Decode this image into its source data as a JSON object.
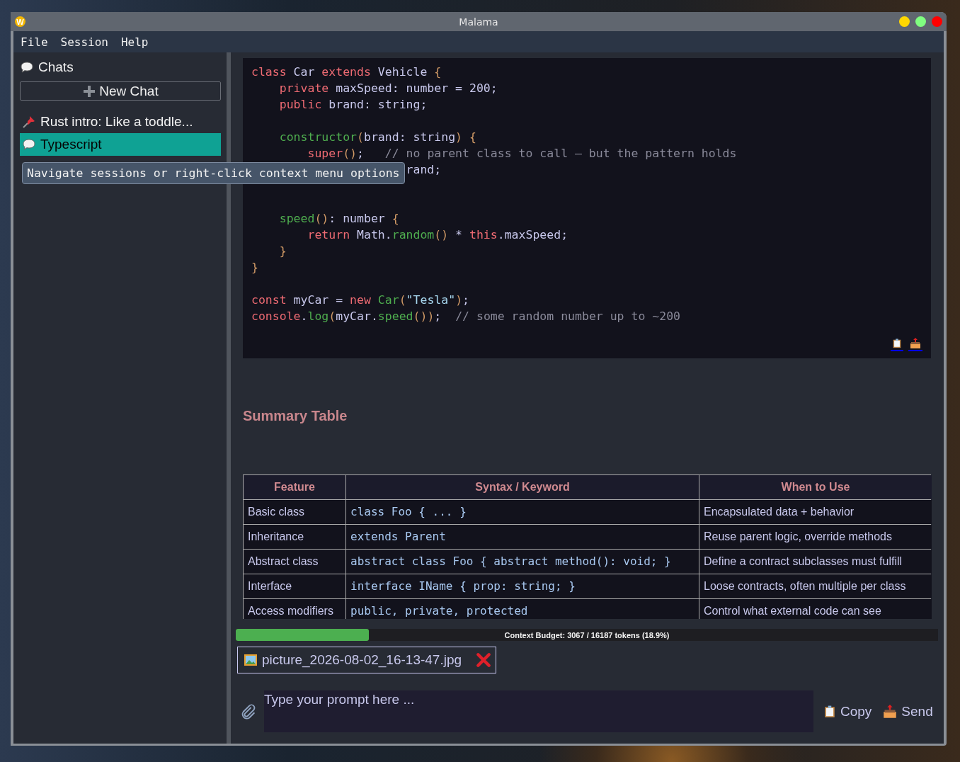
{
  "window": {
    "logo_letter": "W",
    "title": "Malama"
  },
  "menu": [
    "File",
    "Session",
    "Help"
  ],
  "sidebar": {
    "heading": "Chats",
    "new_chat_button": "New Chat",
    "sessions": [
      {
        "kind": "pinned",
        "title": "Rust intro: Like a toddle...",
        "selected": false
      },
      {
        "kind": "chat",
        "title": "Typescript",
        "selected": true
      }
    ]
  },
  "tooltip": "Navigate sessions or right-click context menu options",
  "code_block": {
    "lines": [
      {
        "kind": "code",
        "tokens": [
          {
            "kind": "kw",
            "text": "class"
          },
          {
            "kind": "id",
            "text": " Car "
          },
          {
            "kind": "kw",
            "text": "extends"
          },
          {
            "kind": "id",
            "text": " Vehicle "
          },
          {
            "kind": "p",
            "text": "{"
          }
        ]
      },
      {
        "kind": "code",
        "tokens": [
          {
            "kind": "kw",
            "text": "    private"
          },
          {
            "kind": "id",
            "text": " maxSpeed: number = 200;"
          }
        ]
      },
      {
        "kind": "code",
        "tokens": [
          {
            "kind": "kw",
            "text": "    public"
          },
          {
            "kind": "id",
            "text": " brand: string;"
          }
        ]
      },
      {
        "kind": "blank"
      },
      {
        "kind": "code",
        "tokens": [
          {
            "kind": "fn",
            "text": "    constructor"
          },
          {
            "kind": "p",
            "text": "("
          },
          {
            "kind": "id",
            "text": "brand: string"
          },
          {
            "kind": "p",
            "text": ")"
          },
          {
            "kind": "p",
            "text": " {"
          }
        ]
      },
      {
        "kind": "code",
        "tokens": [
          {
            "kind": "kw",
            "text": "        super"
          },
          {
            "kind": "p",
            "text": "()"
          },
          {
            "kind": "id",
            "text": ";   "
          },
          {
            "kind": "cm",
            "text": "// no parent class to call — but the pattern holds"
          }
        ]
      },
      {
        "kind": "code",
        "tokens": [
          {
            "kind": "id",
            "text": "                      rand;"
          }
        ]
      },
      {
        "kind": "blank"
      },
      {
        "kind": "blank"
      },
      {
        "kind": "code",
        "tokens": [
          {
            "kind": "fn",
            "text": "    speed"
          },
          {
            "kind": "p",
            "text": "()"
          },
          {
            "kind": "id",
            "text": ": number "
          },
          {
            "kind": "p",
            "text": "{"
          }
        ]
      },
      {
        "kind": "code",
        "tokens": [
          {
            "kind": "kw",
            "text": "        return"
          },
          {
            "kind": "id",
            "text": " Math."
          },
          {
            "kind": "fn",
            "text": "random"
          },
          {
            "kind": "p",
            "text": "()"
          },
          {
            "kind": "id",
            "text": " * "
          },
          {
            "kind": "kw",
            "text": "this"
          },
          {
            "kind": "id",
            "text": ".maxSpeed;"
          }
        ]
      },
      {
        "kind": "code",
        "tokens": [
          {
            "kind": "p",
            "text": "    }"
          }
        ]
      },
      {
        "kind": "code",
        "tokens": [
          {
            "kind": "p",
            "text": "}"
          }
        ]
      },
      {
        "kind": "blank"
      },
      {
        "kind": "code",
        "tokens": [
          {
            "kind": "kw",
            "text": "const"
          },
          {
            "kind": "id",
            "text": " myCar = "
          },
          {
            "kind": "kw",
            "text": "new"
          },
          {
            "kind": "fn",
            "text": " Car"
          },
          {
            "kind": "p",
            "text": "("
          },
          {
            "kind": "str",
            "text": "\"Tesla\""
          },
          {
            "kind": "p",
            "text": ")"
          },
          {
            "kind": "id",
            "text": ";"
          }
        ]
      },
      {
        "kind": "code",
        "tokens": [
          {
            "kind": "kw",
            "text": "console"
          },
          {
            "kind": "id",
            "text": "."
          },
          {
            "kind": "fn",
            "text": "log"
          },
          {
            "kind": "p",
            "text": "("
          },
          {
            "kind": "id",
            "text": "myCar."
          },
          {
            "kind": "fn",
            "text": "speed"
          },
          {
            "kind": "p",
            "text": "())"
          },
          {
            "kind": "id",
            "text": ";  "
          },
          {
            "kind": "cm",
            "text": "// some random number up to ~200"
          }
        ]
      }
    ]
  },
  "summary_heading": "Summary Table",
  "table": {
    "columns": [
      "Feature",
      "Syntax / Keyword",
      "When to Use"
    ],
    "rows": [
      [
        "Basic class",
        "class Foo { ... }",
        "Encapsulated data + behavior"
      ],
      [
        "Inheritance",
        "extends Parent",
        "Reuse parent logic, override methods"
      ],
      [
        "Abstract class",
        "abstract class Foo { abstract method(): void; }",
        "Define a contract subclasses must fulfill"
      ],
      [
        "Interface",
        "interface IName { prop: string; }",
        "Loose contracts, often multiple per class"
      ],
      [
        "Access modifiers",
        "public, private, protected",
        "Control what external code can see"
      ]
    ]
  },
  "context_budget": {
    "level": 0.19,
    "label": "Context Budget: 3067 / 16187 tokens (18.9%)"
  },
  "attachment": {
    "filename": "picture_2026-08-02_16-13-47.jpg"
  },
  "prompt": {
    "placeholder": "Type your prompt here ..."
  },
  "buttons": [
    "Copy",
    "Send"
  ]
}
